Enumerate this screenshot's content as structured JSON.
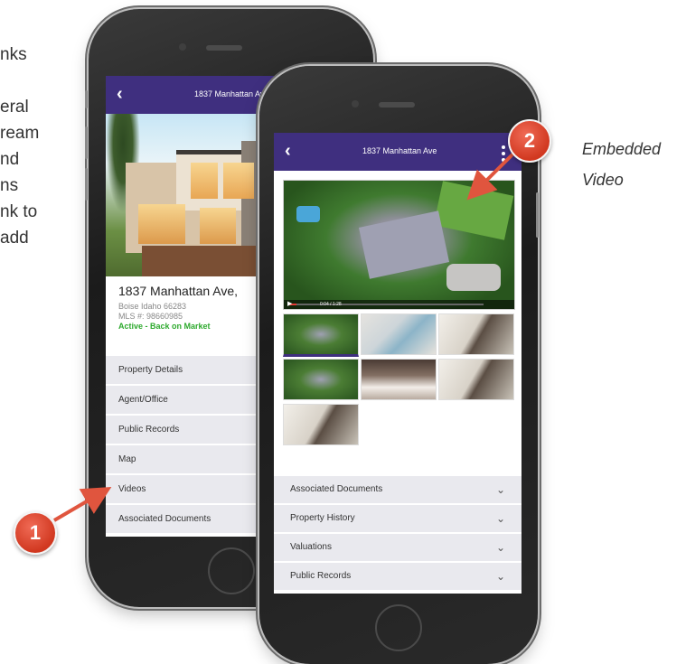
{
  "left_text_lines": [
    "nks",
    "",
    "eral",
    "ream",
    "nd",
    "ns",
    "nk to",
    "add"
  ],
  "phone1": {
    "nav_title": "1837 Manhattan Ave",
    "back_icon": "chevron-left-icon",
    "address": "1837 Manhattan Ave,",
    "city": "Boise Idaho 66283",
    "mls": "MLS #:  98660985",
    "status": "Active - Back on Market",
    "menu": [
      "Property Details",
      "Agent/Office",
      "Public Records",
      "Map",
      "Videos",
      "Associated Documents"
    ]
  },
  "phone2": {
    "nav_title": "1837 Manhattan Ave",
    "back_icon": "chevron-left-icon",
    "menu_icon": "kebab-menu-icon",
    "video_time": "0:04 / 1:28",
    "thumbnails": [
      "aerial",
      "room",
      "chair",
      "aerial",
      "bed",
      "chair",
      "chair"
    ],
    "accordion": [
      "Associated Documents",
      "Property History",
      "Valuations",
      "Public Records"
    ]
  },
  "badges": {
    "one": "1",
    "two": "2"
  },
  "caption": [
    "Embedded",
    "Video"
  ],
  "colors": {
    "navbar": "#3f2f7f",
    "status_green": "#2eaa2e",
    "badge_red": "#d13820",
    "arrow": "#e0553e"
  }
}
